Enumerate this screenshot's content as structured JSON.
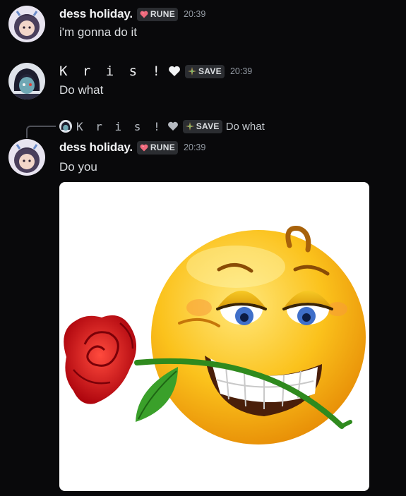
{
  "messages": [
    {
      "author": "dess holiday.",
      "tag": "RUNE",
      "time": "20:39",
      "text": "i'm gonna do it"
    },
    {
      "author": "K r i s !",
      "tag": "SAVE",
      "time": "20:39",
      "text": "Do what"
    },
    {
      "reply": {
        "author": "K r i s !",
        "tag": "SAVE",
        "text": "Do what"
      },
      "author": "dess holiday.",
      "tag": "RUNE",
      "time": "20:39",
      "text": "Do you"
    }
  ],
  "colors": {
    "background": "#09090b",
    "tag_bg": "#2b2d31",
    "rune_heart": "#f06a7d",
    "save_icon": "#c9b15a",
    "timestamp": "#949ba4"
  },
  "attachment": {
    "type": "image",
    "description_icon": "smirking-emoji-with-rose-image"
  }
}
